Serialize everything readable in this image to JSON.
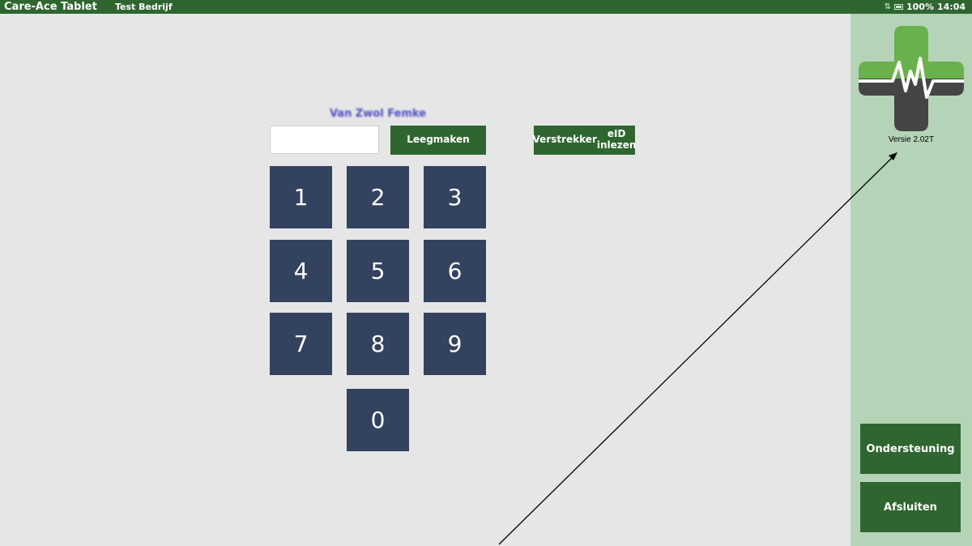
{
  "topbar": {
    "app_title": "Care-Ace Tablet",
    "company": "Test Bedrijf",
    "battery": "100%",
    "time": "14:04"
  },
  "login": {
    "patient_name": "Van Zwol Femke",
    "code_input": {
      "value": "",
      "placeholder": ""
    },
    "clear_label": "Leegmaken",
    "eid_label_line1": "Verstrekker",
    "eid_label_line2": "eID inlezen"
  },
  "keypad": {
    "keys": [
      "1",
      "2",
      "3",
      "4",
      "5",
      "6",
      "7",
      "8",
      "9",
      "0"
    ]
  },
  "sidebar": {
    "version": "Versie 2.02T",
    "support_label": "Ondersteuning",
    "close_label": "Afsluiten"
  },
  "colors": {
    "brand_green": "#2f6630",
    "panel_green": "#b5d3b6",
    "key_navy": "#33425e",
    "logo_light_green": "#6ab04c",
    "logo_dark_gray": "#454545"
  }
}
